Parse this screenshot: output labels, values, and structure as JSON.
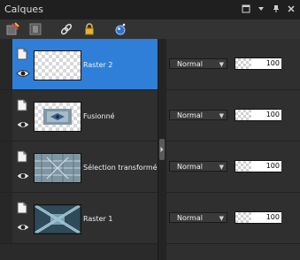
{
  "window": {
    "title": "Calques"
  },
  "toolbar": {
    "icons": [
      "new-layer-icon",
      "mask-icon",
      "link-icon",
      "lock-icon",
      "effects-icon"
    ]
  },
  "layers": [
    {
      "name": "Raster 2",
      "blend": "Normal",
      "opacity": "100",
      "selected": true,
      "thumb": "checker"
    },
    {
      "name": "Fusionné",
      "blend": "Normal",
      "opacity": "100",
      "selected": false,
      "thumb": "merged"
    },
    {
      "name": "Sélection transformée",
      "blend": "Normal",
      "opacity": "100",
      "selected": false,
      "thumb": "pattern"
    },
    {
      "name": "Raster 1",
      "blend": "Normal",
      "opacity": "100",
      "selected": false,
      "thumb": "x-pattern"
    }
  ],
  "colors": {
    "accent": "#2f7fd8",
    "panel": "#2b2b2b"
  }
}
